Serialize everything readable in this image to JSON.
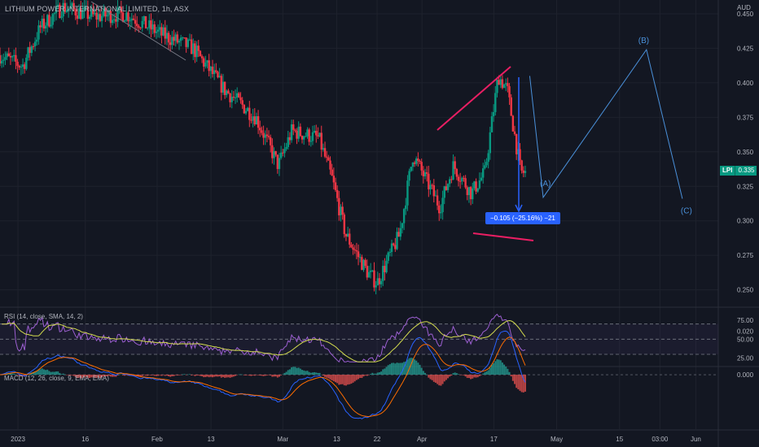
{
  "header": {
    "title": "LITHIUM POWER INTERNATIONAL LIMITED, 1h, ASX"
  },
  "currency": "AUD",
  "current_price": {
    "symbol": "LPI",
    "value": "0.335"
  },
  "measure_label": "−0.105 (−25.16%) −21",
  "wave_labels": [
    "(A)",
    "(B)",
    "(C)"
  ],
  "rsi": {
    "title": "RSI (14, close, SMA, 14, 2)",
    "ticks": [
      "75.00",
      "50.00",
      "25.00"
    ]
  },
  "macd": {
    "title": "MACD (12, 26, close, 9, EMA, EMA)",
    "ticks": [
      "0.020",
      "0.000"
    ]
  },
  "price_ticks": [
    "0.450",
    "0.425",
    "0.400",
    "0.375",
    "0.350",
    "0.325",
    "0.300",
    "0.275",
    "0.250"
  ],
  "time_ticks": [
    "2023",
    "16",
    "Feb",
    "13",
    "Mar",
    "13",
    "22",
    "Apr",
    "17",
    "May",
    "15",
    "03:00",
    "Jun"
  ],
  "colors": {
    "up": "#089981",
    "down": "#f23645",
    "rsi": "#9c5fd1",
    "rsi_ma": "#d4dc4e",
    "macd": "#2962ff",
    "signal": "#ff6d00",
    "trendline": "#e91e63",
    "wave": "#4a90d9",
    "background": "#131722"
  },
  "chart_data": {
    "type": "candlestick",
    "title": "LITHIUM POWER INTERNATIONAL LIMITED, 1h, ASX",
    "ylim": [
      0.238,
      0.46
    ],
    "x_tick_labels": [
      "2023",
      "16",
      "Feb",
      "13",
      "Mar",
      "13",
      "22",
      "Apr",
      "17",
      "May",
      "15",
      "03:00",
      "Jun"
    ],
    "y_tick_labels": [
      "0.450",
      "0.425",
      "0.400",
      "0.375",
      "0.350",
      "0.325",
      "0.300",
      "0.275",
      "0.250"
    ],
    "price_path_keypoints": [
      {
        "date": "2022-12-28",
        "price": 0.42
      },
      {
        "date": "2023-01-02",
        "price": 0.412
      },
      {
        "date": "2023-01-06",
        "price": 0.44
      },
      {
        "date": "2023-01-11",
        "price": 0.455
      },
      {
        "date": "2023-01-18",
        "price": 0.448
      },
      {
        "date": "2023-01-25",
        "price": 0.45
      },
      {
        "date": "2023-02-02",
        "price": 0.435
      },
      {
        "date": "2023-02-09",
        "price": 0.425
      },
      {
        "date": "2023-02-16",
        "price": 0.395
      },
      {
        "date": "2023-02-23",
        "price": 0.375
      },
      {
        "date": "2023-02-28",
        "price": 0.34
      },
      {
        "date": "2023-03-03",
        "price": 0.365
      },
      {
        "date": "2023-03-09",
        "price": 0.36
      },
      {
        "date": "2023-03-12",
        "price": 0.33
      },
      {
        "date": "2023-03-15",
        "price": 0.29
      },
      {
        "date": "2023-03-20",
        "price": 0.262
      },
      {
        "date": "2023-03-22",
        "price": 0.255
      },
      {
        "date": "2023-03-27",
        "price": 0.29
      },
      {
        "date": "2023-03-30",
        "price": 0.348
      },
      {
        "date": "2023-04-05",
        "price": 0.31
      },
      {
        "date": "2023-04-08",
        "price": 0.34
      },
      {
        "date": "2023-04-12",
        "price": 0.32
      },
      {
        "date": "2023-04-15",
        "price": 0.335
      },
      {
        "date": "2023-04-18",
        "price": 0.405
      },
      {
        "date": "2023-04-20",
        "price": 0.395
      },
      {
        "date": "2023-04-23",
        "price": 0.335
      }
    ],
    "current_price": 0.335,
    "measurement": {
      "change": -0.105,
      "percent": -25.16,
      "bars": -21
    },
    "elliott_projection": [
      {
        "label": "",
        "date": "2023-04-25",
        "price": 0.405
      },
      {
        "label": "(A)",
        "date": "2023-04-28",
        "price": 0.317
      },
      {
        "label": "(B)",
        "date": "2023-05-21",
        "price": 0.424
      },
      {
        "label": "(C)",
        "date": "2023-05-29",
        "price": 0.316
      }
    ],
    "rsi": {
      "title": "RSI (14, close, SMA, 14, 2)",
      "levels": [
        70,
        50,
        30
      ],
      "ticks": [
        75,
        50,
        25
      ]
    },
    "macd": {
      "title": "MACD (12, 26, close, 9, EMA, EMA)",
      "ticks": [
        0.02,
        0.0
      ]
    }
  }
}
